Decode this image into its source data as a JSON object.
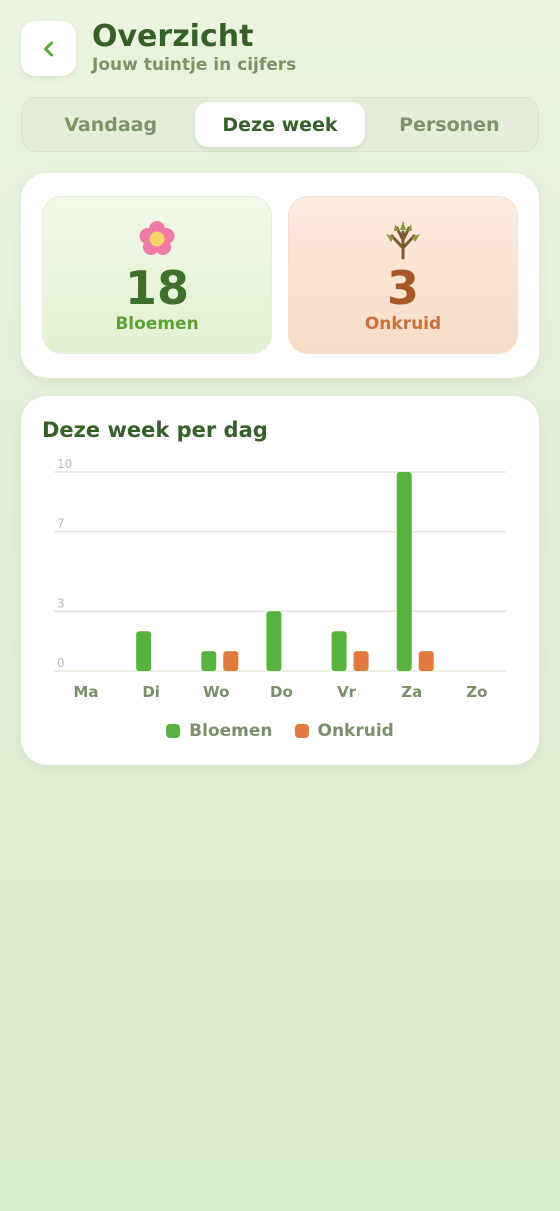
{
  "header": {
    "title": "Overzicht",
    "subtitle": "Jouw tuintje in cijfers",
    "back_icon": "chevron-left-icon"
  },
  "tabs": [
    {
      "label": "Vandaag",
      "active": false
    },
    {
      "label": "Deze week",
      "active": true
    },
    {
      "label": "Personen",
      "active": false
    }
  ],
  "stats": {
    "flowers": {
      "value": "18",
      "label": "Bloemen",
      "icon": "flower-icon"
    },
    "weeds": {
      "value": "3",
      "label": "Onkruid",
      "icon": "weed-icon"
    }
  },
  "colors": {
    "flowers": "#57b33e",
    "weeds": "#e07a3d",
    "grid": "#e4e8dc",
    "tick": "#b7bfae",
    "axis_label": "#7b8f6b"
  },
  "chart_data": {
    "type": "bar",
    "title": "Deze week per dag",
    "categories": [
      "Ma",
      "Di",
      "Wo",
      "Do",
      "Vr",
      "Za",
      "Zo"
    ],
    "series": [
      {
        "name": "Bloemen",
        "values": [
          0,
          2,
          1,
          3,
          2,
          10,
          0
        ]
      },
      {
        "name": "Onkruid",
        "values": [
          0,
          0,
          1,
          0,
          1,
          1,
          0
        ]
      }
    ],
    "yticks": [
      0,
      3,
      7,
      10
    ],
    "ylim": [
      0,
      10
    ],
    "grid": true,
    "legend": "bottom-center"
  }
}
